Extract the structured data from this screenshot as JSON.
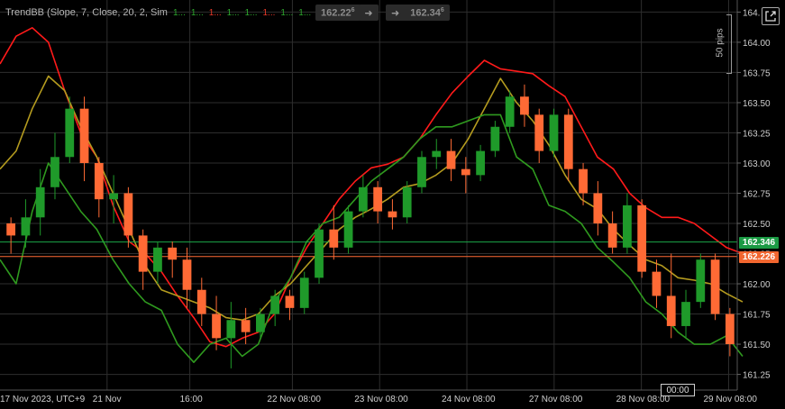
{
  "indicator": {
    "name": "TrendBB (Slope, 7, Close, 20, 2, Sim",
    "values": [
      {
        "text": "1...",
        "color": "#2ea82e"
      },
      {
        "text": "1...",
        "color": "#2ea82e"
      },
      {
        "text": "1...",
        "color": "#e83a2a"
      },
      {
        "text": "1...",
        "color": "#2ea82e"
      },
      {
        "text": "1...",
        "color": "#2ea82e"
      },
      {
        "text": "1...",
        "color": "#e83a2a"
      },
      {
        "text": "1...",
        "color": "#2ea82e"
      },
      {
        "text": "1...",
        "color": "#2ea82e"
      },
      {
        "text": "1...",
        "color": "#e83a2a"
      }
    ]
  },
  "sell_button": {
    "price": "162.22",
    "sup": "6"
  },
  "buy_button": {
    "arrow": "➜",
    "price": "162.34",
    "sup": "6"
  },
  "sell_arrow": "➜",
  "pips_label": "50 pips",
  "bid_tag": "162.226",
  "ask_tag": "162.346",
  "time_box": "00:00",
  "colors": {
    "up": "#1f9a2a",
    "down": "#ff6a35",
    "upper_band": "#ff1a1a",
    "lower_band": "#2f9a1f",
    "mid_band": "#b49b1f",
    "ask_line": "#1ba64a",
    "bid_line": "#ff6a35",
    "grid": "#2e2e2e"
  },
  "chart_data": {
    "type": "candlestick",
    "symbol_timezone": "UTC+9",
    "y_axis": {
      "ticks": [
        "164.",
        "164.00",
        "163.75",
        "163.50",
        "163.25",
        "163.00",
        "162.75",
        "162.50",
        "162.25",
        "162.00",
        "161.75",
        "161.50",
        "161.25"
      ],
      "values": [
        164.25,
        164.0,
        163.75,
        163.5,
        163.25,
        163.0,
        162.75,
        162.5,
        162.25,
        162.0,
        161.75,
        161.5,
        161.25
      ],
      "ylim": [
        161.12,
        164.35
      ]
    },
    "x_axis": {
      "labels": [
        "17 Nov 2023, UTC+9",
        "21 Nov",
        "16:00",
        "22 Nov 08:00",
        "23 Nov 08:00",
        "24 Nov 08:00",
        "27 Nov 08:00",
        "28 Nov 08:00",
        "29 Nov 08:00"
      ]
    },
    "bid": 162.226,
    "ask": 162.346,
    "series": [
      {
        "name": "upper_band",
        "values": [
          163.82,
          164.05,
          164.12,
          164.0,
          163.6,
          163.25,
          163.05,
          162.65,
          162.35,
          162.25,
          162.1,
          161.9,
          161.72,
          161.52,
          161.48,
          161.55,
          161.6,
          161.75,
          162.05,
          162.3,
          162.5,
          162.7,
          162.85,
          162.96,
          162.99,
          163.05,
          163.2,
          163.4,
          163.58,
          163.72,
          163.85,
          163.78,
          163.76,
          163.74,
          163.64,
          163.55,
          163.3,
          163.05,
          162.95,
          162.75,
          162.63,
          162.55,
          162.55,
          162.5,
          162.4,
          162.3,
          162.25
        ]
      },
      {
        "name": "mid_band",
        "values": [
          162.95,
          163.1,
          163.45,
          163.72,
          163.6,
          163.3,
          163.05,
          162.75,
          162.45,
          162.15,
          161.95,
          161.9,
          161.85,
          161.8,
          161.72,
          161.7,
          161.75,
          161.9,
          162.0,
          162.15,
          162.3,
          162.45,
          162.55,
          162.62,
          162.7,
          162.8,
          162.83,
          162.9,
          163.0,
          163.2,
          163.45,
          163.7,
          163.5,
          163.35,
          163.15,
          162.9,
          162.7,
          162.62,
          162.45,
          162.32,
          162.2,
          162.15,
          162.05,
          162.03,
          162.0,
          161.92,
          161.85
        ]
      },
      {
        "name": "lower_band",
        "values": [
          162.2,
          162.0,
          162.6,
          163.0,
          162.8,
          162.6,
          162.45,
          162.2,
          162.0,
          161.85,
          161.78,
          161.5,
          161.35,
          161.5,
          161.55,
          161.4,
          161.5,
          161.85,
          162.05,
          162.35,
          162.5,
          162.55,
          162.7,
          162.85,
          162.95,
          163.05,
          163.2,
          163.3,
          163.3,
          163.35,
          163.4,
          163.4,
          163.05,
          162.95,
          162.65,
          162.6,
          162.5,
          162.3,
          162.18,
          162.05,
          161.85,
          161.75,
          161.6,
          161.5,
          161.5,
          161.57,
          161.4
        ]
      },
      {
        "name": "candles",
        "ohlc": [
          [
            162.5,
            162.55,
            162.25,
            162.4
          ],
          [
            162.4,
            162.7,
            162.3,
            162.55
          ],
          [
            162.55,
            162.95,
            162.4,
            162.8
          ],
          [
            162.8,
            163.25,
            162.7,
            163.05
          ],
          [
            163.05,
            163.55,
            163.0,
            163.45
          ],
          [
            163.45,
            163.55,
            162.85,
            163.0
          ],
          [
            163.0,
            163.05,
            162.55,
            162.7
          ],
          [
            162.7,
            162.9,
            162.5,
            162.75
          ],
          [
            162.75,
            162.8,
            162.3,
            162.4
          ],
          [
            162.4,
            162.45,
            161.95,
            162.1
          ],
          [
            162.1,
            162.35,
            162.0,
            162.3
          ],
          [
            162.3,
            162.35,
            162.05,
            162.2
          ],
          [
            162.2,
            162.3,
            161.8,
            161.95
          ],
          [
            161.95,
            162.05,
            161.65,
            161.75
          ],
          [
            161.75,
            161.9,
            161.45,
            161.55
          ],
          [
            161.55,
            161.85,
            161.3,
            161.7
          ],
          [
            161.7,
            161.8,
            161.5,
            161.6
          ],
          [
            161.6,
            161.8,
            161.55,
            161.75
          ],
          [
            161.75,
            161.95,
            161.65,
            161.9
          ],
          [
            161.9,
            161.95,
            161.7,
            161.8
          ],
          [
            161.8,
            162.1,
            161.75,
            162.05
          ],
          [
            162.05,
            162.5,
            162.0,
            162.45
          ],
          [
            162.45,
            162.65,
            162.2,
            162.3
          ],
          [
            162.3,
            162.65,
            162.25,
            162.6
          ],
          [
            162.6,
            162.9,
            162.55,
            162.8
          ],
          [
            162.8,
            162.85,
            162.5,
            162.6
          ],
          [
            162.6,
            162.7,
            162.45,
            162.55
          ],
          [
            162.55,
            162.85,
            162.5,
            162.8
          ],
          [
            162.8,
            163.1,
            162.75,
            163.05
          ],
          [
            163.05,
            163.2,
            162.95,
            163.1
          ],
          [
            163.1,
            163.2,
            162.85,
            162.95
          ],
          [
            162.95,
            163.05,
            162.75,
            162.9
          ],
          [
            162.9,
            163.15,
            162.85,
            163.1
          ],
          [
            163.1,
            163.35,
            163.05,
            163.3
          ],
          [
            163.3,
            163.6,
            163.25,
            163.55
          ],
          [
            163.55,
            163.65,
            163.3,
            163.4
          ],
          [
            163.4,
            163.45,
            163.0,
            163.1
          ],
          [
            163.1,
            163.45,
            163.05,
            163.4
          ],
          [
            163.4,
            163.45,
            162.85,
            162.95
          ],
          [
            162.95,
            163.0,
            162.65,
            162.75
          ],
          [
            162.75,
            162.85,
            162.4,
            162.5
          ],
          [
            162.5,
            162.6,
            162.25,
            162.3
          ],
          [
            162.3,
            162.75,
            162.25,
            162.65
          ],
          [
            162.65,
            162.7,
            162.05,
            162.1
          ],
          [
            162.1,
            162.2,
            161.8,
            161.9
          ],
          [
            161.9,
            162.25,
            161.55,
            161.65
          ],
          [
            161.65,
            161.95,
            161.55,
            161.85
          ],
          [
            161.85,
            162.25,
            161.8,
            162.2
          ],
          [
            162.2,
            162.25,
            161.7,
            161.75
          ],
          [
            161.75,
            161.8,
            161.4,
            161.5
          ]
        ]
      }
    ]
  }
}
